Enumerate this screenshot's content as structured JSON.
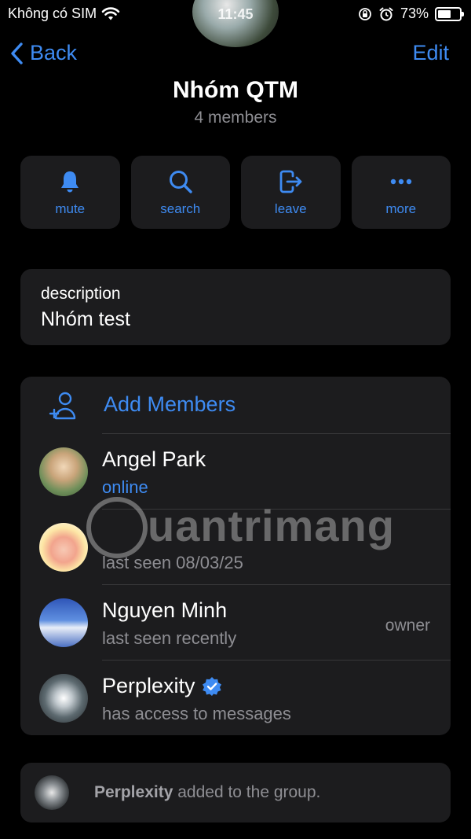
{
  "status_bar": {
    "carrier": "Không có SIM",
    "time": "11:45",
    "battery": "73%",
    "battery_level": 0.73
  },
  "nav": {
    "back_label": "Back",
    "edit_label": "Edit"
  },
  "group": {
    "title": "Nhóm QTM",
    "subtitle": "4 members"
  },
  "actions": [
    {
      "label": "mute",
      "icon": "bell-icon"
    },
    {
      "label": "search",
      "icon": "search-icon"
    },
    {
      "label": "leave",
      "icon": "leave-icon"
    },
    {
      "label": "more",
      "icon": "more-icon"
    }
  ],
  "description": {
    "label": "description",
    "value": "Nhóm test"
  },
  "members": {
    "add_label": "Add Members",
    "list": [
      {
        "name": "Angel Park",
        "status": "online",
        "role": ""
      },
      {
        "name": "",
        "status": "last seen 08/03/25",
        "role": ""
      },
      {
        "name": "Nguyen Minh",
        "status": "last seen recently",
        "role": "owner"
      },
      {
        "name": "Perplexity",
        "status": "has access to messages",
        "role": ""
      }
    ]
  },
  "event": {
    "actor": "Perplexity",
    "text": " added to the group."
  },
  "watermark": "uantrimang",
  "colors": {
    "accent": "#3e8bf2",
    "card": "#1c1c1e",
    "secondary_text": "#8e8e93",
    "background": "#000000"
  }
}
